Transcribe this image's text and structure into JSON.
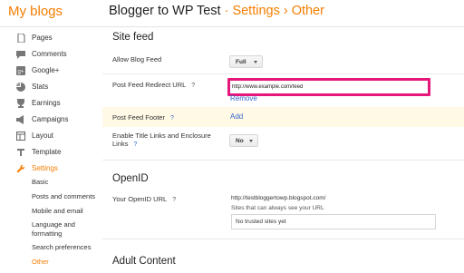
{
  "header": {
    "brand": "My blogs",
    "blog_name": "Blogger to WP Test",
    "separator": "·",
    "crumb_settings": "Settings",
    "crumb_arrow": "›",
    "crumb_current": "Other"
  },
  "sidebar": {
    "items": [
      {
        "label": "Pages",
        "icon": "page-icon"
      },
      {
        "label": "Comments",
        "icon": "comment-icon"
      },
      {
        "label": "Google+",
        "icon": "google-plus-icon"
      },
      {
        "label": "Stats",
        "icon": "stats-icon"
      },
      {
        "label": "Earnings",
        "icon": "earnings-icon"
      },
      {
        "label": "Campaigns",
        "icon": "campaigns-icon"
      },
      {
        "label": "Layout",
        "icon": "layout-icon"
      },
      {
        "label": "Template",
        "icon": "template-icon"
      },
      {
        "label": "Settings",
        "icon": "wrench-icon"
      }
    ],
    "sub_items": [
      {
        "label": "Basic"
      },
      {
        "label": "Posts and comments"
      },
      {
        "label": "Mobile and email"
      },
      {
        "label": "Language and"
      },
      {
        "label": "formatting"
      },
      {
        "label": "Search preferences"
      },
      {
        "label": "Other"
      }
    ]
  },
  "site_feed": {
    "title": "Site feed",
    "allow_label": "Allow Blog Feed",
    "allow_value": "Full",
    "redirect_label": "Post Feed Redirect URL",
    "redirect_value": "http://www.example.com/feed",
    "remove_link": "Remove",
    "footer_label": "Post Feed Footer",
    "footer_add": "Add",
    "enclosure_label_1": "Enable Title Links and Enclosure",
    "enclosure_label_2": "Links",
    "enclosure_value": "No",
    "help": "?"
  },
  "openid": {
    "title": "OpenID",
    "url_label": "Your OpenID URL",
    "url_value": "http://testbloggertowp.blogspot.com/",
    "trusted_caption": "Sites that can always see your URL",
    "trusted_empty": "No trusted sites yet"
  },
  "adult": {
    "title": "Adult Content"
  },
  "colors": {
    "accent": "#f57d00",
    "link": "#3366cc",
    "highlight_border": "#e5177a"
  }
}
